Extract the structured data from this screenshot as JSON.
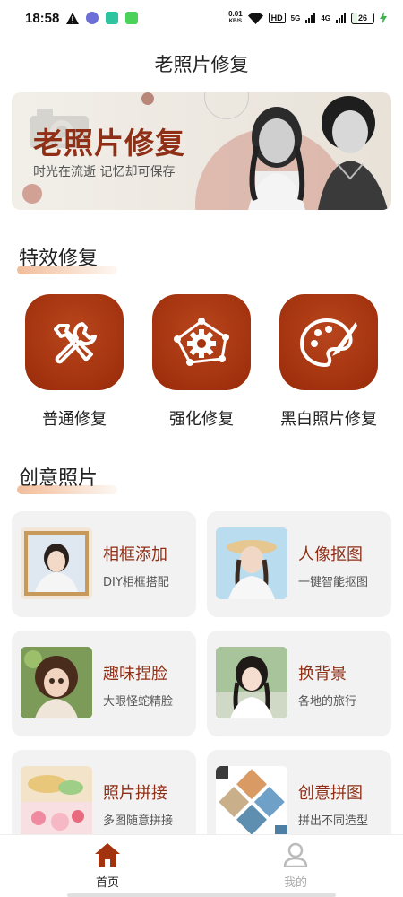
{
  "status": {
    "time": "18:58",
    "net_speed_value": "0.01",
    "net_speed_unit": "KB/S",
    "hd": "HD",
    "sig1": "5G",
    "sig2": "4G",
    "battery": "26"
  },
  "header": {
    "title": "老照片修复"
  },
  "banner": {
    "title": "老照片修复",
    "subtitle": "时光在流逝 记忆却可保存"
  },
  "effects_section": {
    "heading": "特效修复",
    "items": [
      {
        "label": "普通修复",
        "icon": "tools-icon"
      },
      {
        "label": "强化修复",
        "icon": "gear-network-icon"
      },
      {
        "label": "黑白照片修复",
        "icon": "palette-icon"
      }
    ]
  },
  "creative_section": {
    "heading": "创意照片",
    "cards": [
      {
        "title": "相框添加",
        "subtitle": "DIY相框搭配"
      },
      {
        "title": "人像抠图",
        "subtitle": "一键智能抠图"
      },
      {
        "title": "趣味捏脸",
        "subtitle": "大眼怪蛇精脸"
      },
      {
        "title": "换背景",
        "subtitle": "各地的旅行"
      },
      {
        "title": "照片拼接",
        "subtitle": "多图随意拼接"
      },
      {
        "title": "创意拼图",
        "subtitle": "拼出不同造型"
      }
    ]
  },
  "tabbar": {
    "home": "首页",
    "mine": "我的"
  },
  "colors": {
    "accent": "#a3330f",
    "title_red": "#8e2f16",
    "card_bg": "#f2f2f2"
  }
}
